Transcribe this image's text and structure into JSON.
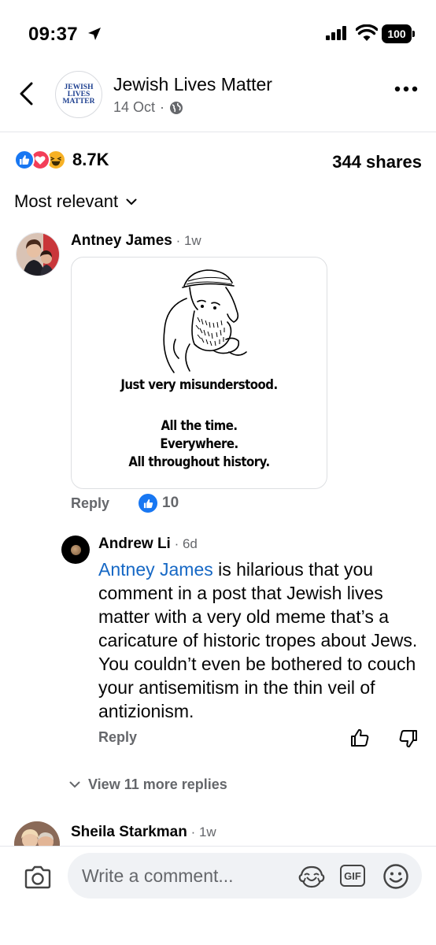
{
  "status_bar": {
    "time": "09:37",
    "battery": "100"
  },
  "post_header": {
    "page_name": "Jewish Lives Matter",
    "date": "14 Oct",
    "separator": "·",
    "avatar_logo_lines": [
      "JEWISH",
      "LIVES",
      "MATTER"
    ]
  },
  "stats": {
    "reaction_count": "8.7K",
    "shares": "344 shares"
  },
  "sort": {
    "label": "Most relevant"
  },
  "comments": [
    {
      "author": "Antney James",
      "time": " · 1w",
      "meme_text": [
        "Just very misunderstood.",
        "All the time.",
        "Everywhere.",
        "All throughout history."
      ],
      "reply_label": "Reply",
      "like_count": "10"
    },
    {
      "author": "Andrew Li",
      "time": " · 6d",
      "mention": "Antney James",
      "text": " is hilarious that you comment in a post that Jewish lives matter with a very old meme that’s a caricature of historic tropes about Jews. You couldn’t even be bothered to couch your antisemitism in the thin veil of antizionism.",
      "reply_label": "Reply"
    },
    {
      "author": "Sheila Starkman",
      "time": " · 1w"
    }
  ],
  "view_more": {
    "label": "View 11 more replies"
  },
  "composer": {
    "placeholder": "Write a comment...",
    "gif_label": "GIF"
  },
  "colors": {
    "accent": "#1877f2",
    "mention": "#1668c5",
    "secondary_text": "#65676b",
    "love": "#f33e58",
    "haha": "#f7b125"
  }
}
